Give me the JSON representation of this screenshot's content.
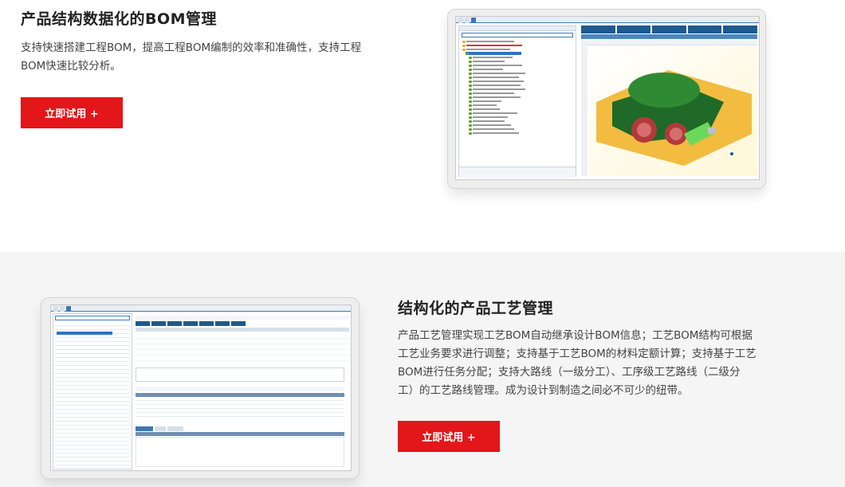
{
  "section1": {
    "title": "产品结构数据化的BOM管理",
    "description_line1": "支持快速搭建工程BOM，提高工程BOM编制的效率和准确性，支持工程",
    "description_line2": "BOM快速比较分析。",
    "cta_label": "立即试用 +"
  },
  "section2": {
    "title": "结构化的产品工艺管理",
    "description_line1": "产品工艺管理实现工艺BOM自动继承设计BOM信息；工艺BOM结构可根据",
    "description_line2": "工艺业务要求进行调整；支持基于工艺BOM的材料定额计算；支持基于工艺",
    "description_line3": "BOM进行任务分配；支持大路线（一级分工）、工序级工艺路线（二级分",
    "description_line4": "工）的工艺路线管理。成为设计到制造之间必不可少的纽带。",
    "cta_label": "立即试用 +"
  },
  "colors": {
    "accent": "#e31619",
    "bottom_bg": "#f5f5f5",
    "ui_blue": "#3b78b8"
  }
}
